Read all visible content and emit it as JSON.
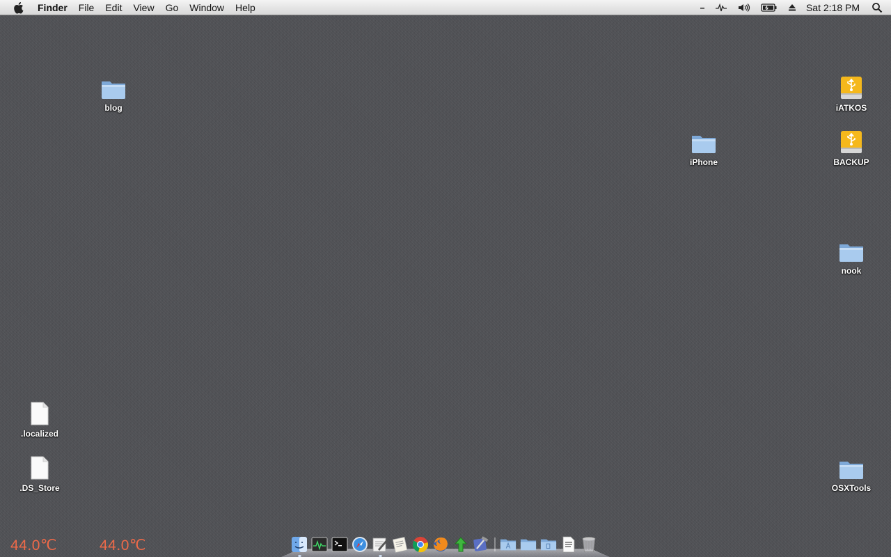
{
  "menubar": {
    "app_name": "Finder",
    "menus": [
      "File",
      "Edit",
      "View",
      "Go",
      "Window",
      "Help"
    ],
    "clock": "Sat 2:18 PM",
    "status_icons": [
      "dash-icon",
      "activity-icon",
      "volume-icon",
      "battery-icon",
      "eject-icon",
      "spotlight-search-icon"
    ]
  },
  "desktop": {
    "icons": [
      {
        "label": "blog",
        "kind": "folder"
      },
      {
        "label": "iPhone",
        "kind": "folder"
      },
      {
        "label": "iATKOS",
        "kind": "usb-drive"
      },
      {
        "label": "BACKUP",
        "kind": "usb-drive"
      },
      {
        "label": "nook",
        "kind": "folder"
      },
      {
        "label": ".localized",
        "kind": "document"
      },
      {
        "label": ".DS_Store",
        "kind": "document"
      },
      {
        "label": "OSXTools",
        "kind": "folder"
      }
    ]
  },
  "widgets": {
    "temps": [
      "44.0℃",
      "44.0℃"
    ],
    "temp_color": "#ef6a49"
  },
  "dock": {
    "apps": [
      "finder-icon",
      "activity-monitor-icon",
      "terminal-icon",
      "safari-icon",
      "textedit-icon",
      "preview-icon",
      "chrome-icon",
      "firefox-icon",
      "upload-app-icon",
      "xcode-icon"
    ],
    "stacks": [
      "applications-stack-icon",
      "documents-stack-icon",
      "downloads-stack-icon",
      "file-icon",
      "trash-icon"
    ]
  },
  "colors": {
    "desktop_bg": "#4f5054",
    "folder_blue": "#9cc3ea",
    "drive_yellow": "#f5b81c"
  }
}
